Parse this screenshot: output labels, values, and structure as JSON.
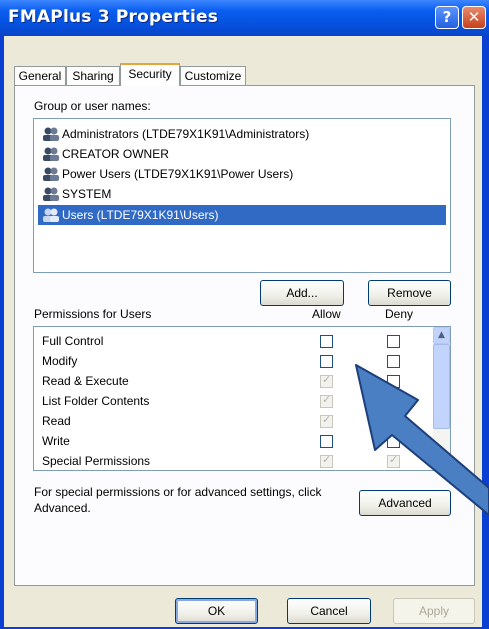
{
  "window": {
    "title": "FMAPlus 3 Properties",
    "help_glyph": "?",
    "close_glyph": "✕"
  },
  "tabs": [
    {
      "label": "General",
      "active": false
    },
    {
      "label": "Sharing",
      "active": false
    },
    {
      "label": "Security",
      "active": true
    },
    {
      "label": "Customize",
      "active": false
    }
  ],
  "group_label": "Group or user names:",
  "users": [
    {
      "name": "Administrators (LTDE79X1K91\\Administrators)",
      "selected": false
    },
    {
      "name": "CREATOR OWNER",
      "selected": false
    },
    {
      "name": "Power Users (LTDE79X1K91\\Power Users)",
      "selected": false
    },
    {
      "name": "SYSTEM",
      "selected": false
    },
    {
      "name": "Users (LTDE79X1K91\\Users)",
      "selected": true
    }
  ],
  "buttons": {
    "add": "Add...",
    "remove": "Remove",
    "advanced": "Advanced",
    "ok": "OK",
    "cancel": "Cancel",
    "apply": "Apply"
  },
  "permissions_label": "Permissions for Users",
  "allow_label": "Allow",
  "deny_label": "Deny",
  "permissions": [
    {
      "name": "Full Control",
      "allow": false,
      "allow_inherited": false,
      "deny": false
    },
    {
      "name": "Modify",
      "allow": false,
      "allow_inherited": false,
      "deny": false
    },
    {
      "name": "Read & Execute",
      "allow": true,
      "allow_inherited": true,
      "deny": false
    },
    {
      "name": "List Folder Contents",
      "allow": true,
      "allow_inherited": true,
      "deny": false
    },
    {
      "name": "Read",
      "allow": true,
      "allow_inherited": true,
      "deny": false
    },
    {
      "name": "Write",
      "allow": false,
      "allow_inherited": false,
      "deny": false
    },
    {
      "name": "Special Permissions",
      "allow": false,
      "allow_inherited": false,
      "deny": false
    }
  ],
  "advanced_note": "For special permissions or for advanced settings, click Advanced.",
  "colors": {
    "title_bar": "#0a5ef0",
    "selection": "#316ac5",
    "annotation_arrow": "#4a7fc4"
  }
}
